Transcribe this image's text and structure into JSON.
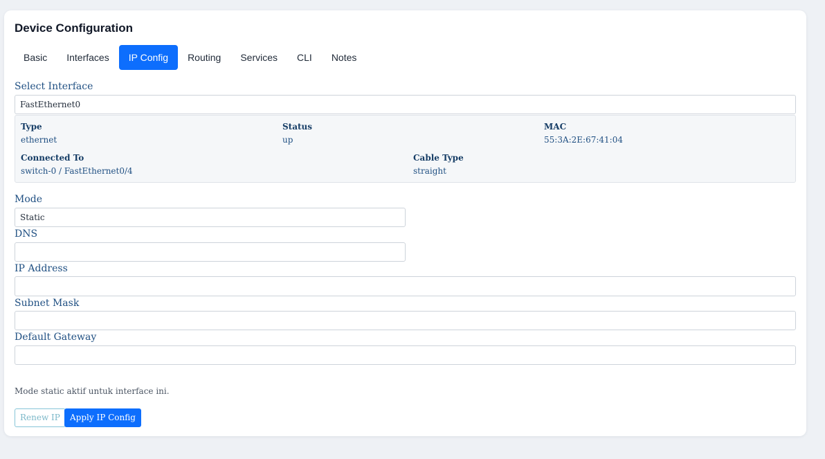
{
  "panel": {
    "title": "Device Configuration"
  },
  "tabs": [
    {
      "label": "Basic",
      "active": false
    },
    {
      "label": "Interfaces",
      "active": false
    },
    {
      "label": "IP Config",
      "active": true
    },
    {
      "label": "Routing",
      "active": false
    },
    {
      "label": "Services",
      "active": false
    },
    {
      "label": "CLI",
      "active": false
    },
    {
      "label": "Notes",
      "active": false
    }
  ],
  "interface_select": {
    "label": "Select Interface",
    "value": "FastEthernet0"
  },
  "interface_info": {
    "type": {
      "label": "Type",
      "value": "ethernet"
    },
    "status": {
      "label": "Status",
      "value": "up"
    },
    "mac": {
      "label": "MAC",
      "value": "55:3A:2E:67:41:04"
    },
    "connected_to": {
      "label": "Connected To",
      "value": "switch-0 / FastEthernet0/4"
    },
    "cable_type": {
      "label": "Cable Type",
      "value": "straight"
    }
  },
  "form": {
    "mode": {
      "label": "Mode",
      "value": "Static"
    },
    "dns": {
      "label": "DNS",
      "value": ""
    },
    "ip_address": {
      "label": "IP Address",
      "value": ""
    },
    "subnet_mask": {
      "label": "Subnet Mask",
      "value": ""
    },
    "default_gateway": {
      "label": "Default Gateway",
      "value": ""
    }
  },
  "note": "Mode static aktif untuk interface ini.",
  "actions": {
    "renew_label": "Renew IP",
    "apply_label": "Apply IP Config"
  },
  "colors": {
    "accent": "#0d6efd",
    "label_text": "#1f4f82",
    "page_bg": "#eef1f5"
  }
}
